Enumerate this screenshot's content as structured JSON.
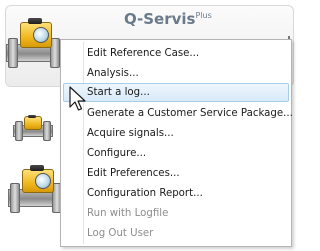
{
  "header": {
    "brand_name": "Q-Servis",
    "brand_suffix": "Plus"
  },
  "context_menu": {
    "items": [
      {
        "label": "Edit Reference Case...",
        "enabled": true
      },
      {
        "label": "Analysis...",
        "enabled": true
      },
      {
        "label": "Start a log...",
        "enabled": true,
        "hovered": true
      },
      {
        "label": "Generate a Customer Service Package...",
        "enabled": true
      },
      {
        "label": "Acquire signals...",
        "enabled": true
      },
      {
        "label": "Configure...",
        "enabled": true
      },
      {
        "label": "Edit Preferences...",
        "enabled": true
      },
      {
        "label": "Configuration Report...",
        "enabled": true
      },
      {
        "label": "Run with Logfile",
        "enabled": false
      },
      {
        "label": "Log Out User",
        "enabled": false
      }
    ]
  },
  "colors": {
    "menu_text": "#1a1a1a",
    "menu_disabled_text": "#8d8d8d",
    "hover_bg": "#d8eaf9",
    "hover_border": "#a8cde9",
    "device_body": "#f0b81f"
  },
  "icons": {
    "device": "flowmeter-device-icon",
    "cursor": "mouse-pointer-icon"
  }
}
